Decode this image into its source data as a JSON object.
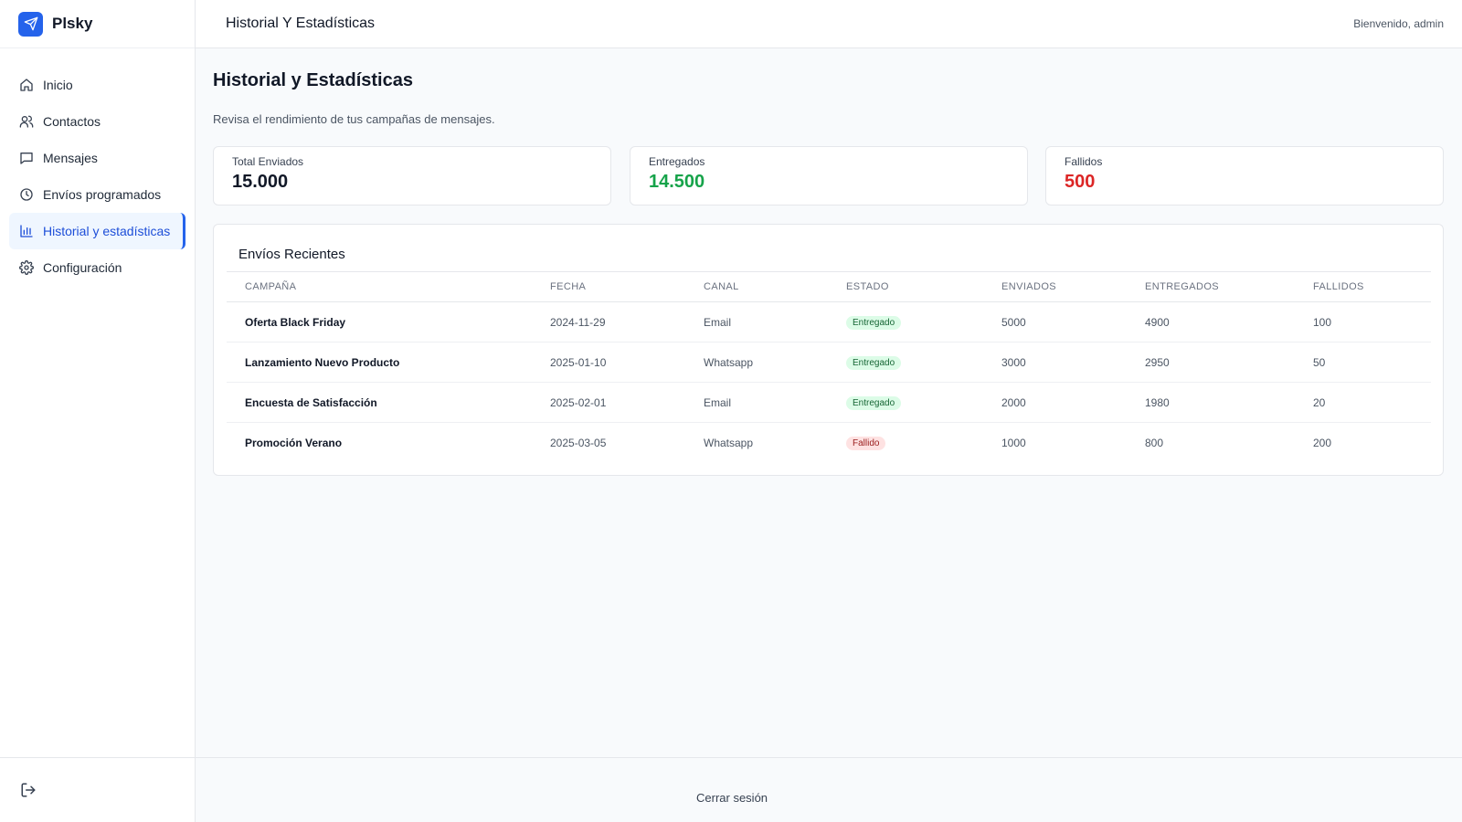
{
  "app": {
    "name": "Plsky"
  },
  "header": {
    "title": "Historial Y Estadísticas",
    "welcome": "Bienvenido, admin"
  },
  "sidebar": {
    "items": [
      {
        "label": "Inicio",
        "icon": "home-icon",
        "active": false
      },
      {
        "label": "Contactos",
        "icon": "users-icon",
        "active": false
      },
      {
        "label": "Mensajes",
        "icon": "message-icon",
        "active": false
      },
      {
        "label": "Envíos programados",
        "icon": "clock-icon",
        "active": false
      },
      {
        "label": "Historial y estadísticas",
        "icon": "bar-chart-icon",
        "active": true
      },
      {
        "label": "Configuración",
        "icon": "gear-icon",
        "active": false
      }
    ],
    "footer_icon": "logout-icon"
  },
  "page": {
    "title": "Historial y Estadísticas",
    "subtitle": "Revisa el rendimiento de tus campañas de mensajes."
  },
  "stats": [
    {
      "label": "Total Enviados",
      "value": "15.000",
      "color": "#111827"
    },
    {
      "label": "Entregados",
      "value": "14.500",
      "color": "#16a34a"
    },
    {
      "label": "Fallidos",
      "value": "500",
      "color": "#dc2626"
    }
  ],
  "table": {
    "title": "Envíos Recientes",
    "columns": [
      "CAMPAÑA",
      "FECHA",
      "CANAL",
      "ESTADO",
      "ENVIADOS",
      "ENTREGADOS",
      "FALLIDOS"
    ],
    "rows": [
      {
        "campaign": "Oferta Black Friday",
        "date": "2024-11-29",
        "channel": "Email",
        "status": "Entregado",
        "status_type": "success",
        "sent": "5000",
        "delivered": "4900",
        "failed": "100"
      },
      {
        "campaign": "Lanzamiento Nuevo Producto",
        "date": "2025-01-10",
        "channel": "Whatsapp",
        "status": "Entregado",
        "status_type": "success",
        "sent": "3000",
        "delivered": "2950",
        "failed": "50"
      },
      {
        "campaign": "Encuesta de Satisfacción",
        "date": "2025-02-01",
        "channel": "Email",
        "status": "Entregado",
        "status_type": "success",
        "sent": "2000",
        "delivered": "1980",
        "failed": "20"
      },
      {
        "campaign": "Promoción Verano",
        "date": "2025-03-05",
        "channel": "Whatsapp",
        "status": "Fallido",
        "status_type": "error",
        "sent": "1000",
        "delivered": "800",
        "failed": "200"
      }
    ]
  },
  "footer": {
    "logout_label": "Cerrar sesión"
  },
  "colors": {
    "accent": "#2563eb",
    "success_bg": "#dcfce7",
    "success_fg": "#166534",
    "error_bg": "#fee2e2",
    "error_fg": "#991b1b"
  }
}
